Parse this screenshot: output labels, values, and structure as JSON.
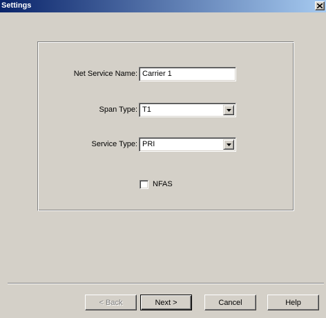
{
  "window": {
    "title": "Settings",
    "close_label": "×"
  },
  "form": {
    "net_service_name_label": "Net Service Name:",
    "net_service_name_value": "Carrier 1",
    "span_type_label": "Span Type:",
    "span_type_value": "T1",
    "service_type_label": "Service Type:",
    "service_type_value": "PRI",
    "nfas_label": "NFAS",
    "nfas_checked": false
  },
  "buttons": {
    "back": "< Back",
    "next": "Next >",
    "cancel": "Cancel",
    "help": "Help"
  },
  "colors": {
    "title_start": "#0a246a",
    "title_end": "#a6caf0",
    "face": "#d4d0c8"
  },
  "icons": {
    "close": "close-icon",
    "dropdown": "chevron-down-icon"
  }
}
